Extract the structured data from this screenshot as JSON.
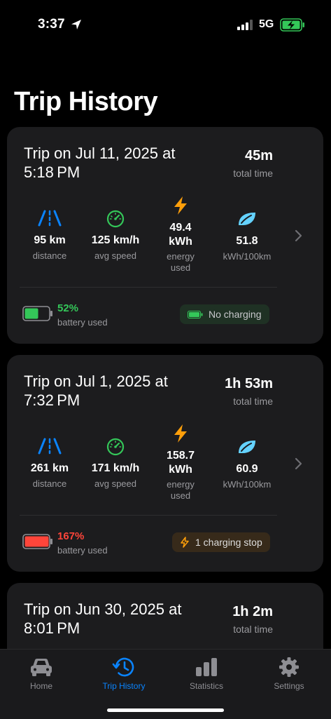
{
  "status": {
    "time": "3:37",
    "network": "5G"
  },
  "page": {
    "title": "Trip History"
  },
  "trips": [
    {
      "title": "Trip on Jul 11, 2025 at 5:18 PM",
      "duration": "45m",
      "duration_label": "total time",
      "distance": "95 km",
      "distance_label": "distance",
      "speed": "125 km/h",
      "speed_label": "avg speed",
      "energy": "49.4 kWh",
      "energy_label": "energy used",
      "efficiency": "51.8",
      "efficiency_label": "kWh/100km",
      "battery_pct": "52%",
      "battery_label": "battery used",
      "battery_color": "#34c759",
      "charging": "No charging"
    },
    {
      "title": "Trip on Jul 1, 2025 at 7:32 PM",
      "duration": "1h 53m",
      "duration_label": "total time",
      "distance": "261 km",
      "distance_label": "distance",
      "speed": "171 km/h",
      "speed_label": "avg speed",
      "energy": "158.7 kWh",
      "energy_label": "energy used",
      "efficiency": "60.9",
      "efficiency_label": "kWh/100km",
      "battery_pct": "167%",
      "battery_label": "battery used",
      "battery_color": "#ff453a",
      "charging": "1 charging stop"
    },
    {
      "title": "Trip on Jun 30, 2025 at 8:01 PM",
      "duration": "1h 2m",
      "duration_label": "total time"
    }
  ],
  "tabs": [
    {
      "label": "Home",
      "icon": "car-icon"
    },
    {
      "label": "Trip History",
      "icon": "history-icon"
    },
    {
      "label": "Statistics",
      "icon": "chart-icon"
    },
    {
      "label": "Settings",
      "icon": "gear-icon"
    }
  ],
  "colors": {
    "accent": "#0a84ff",
    "distance_icon": "#0a84ff",
    "speed_icon": "#34c759",
    "energy_icon": "#ff9f0a",
    "efficiency_icon": "#64d2ff",
    "card_bg": "#1c1c1e"
  }
}
